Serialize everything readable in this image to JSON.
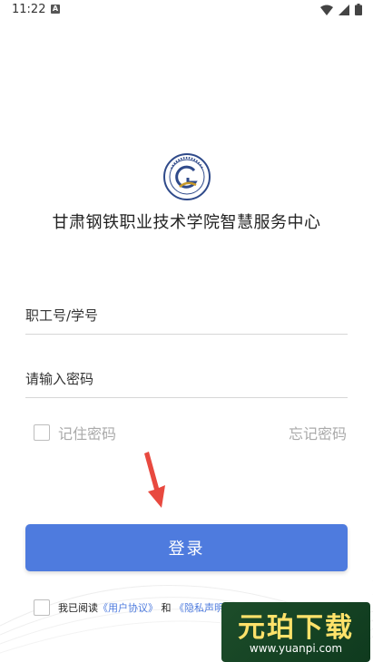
{
  "status_bar": {
    "time": "11:22",
    "notification_letter": "A",
    "icons": [
      "wifi-icon",
      "signal-icon",
      "battery-icon"
    ]
  },
  "header": {
    "logo_icon": "school-seal-icon",
    "title": "甘肃钢铁职业技术学院智慧服务中心"
  },
  "form": {
    "username_placeholder": "职工号/学号",
    "password_placeholder": "请输入密码",
    "remember_label": "记住密码",
    "forgot_label": "忘记密码",
    "login_label": "登录"
  },
  "agreement": {
    "prefix": "我已阅读",
    "user_agreement": "《用户协议》",
    "conjunction": "和",
    "privacy": "《隐私声明》"
  },
  "watermark": {
    "name": "元珀下载",
    "url": "www.yuanpi.com"
  },
  "colors": {
    "accent": "#4e7bde",
    "arrow": "#e8493f"
  }
}
